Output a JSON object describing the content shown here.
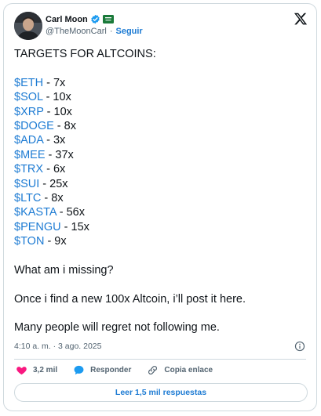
{
  "author": {
    "name": "Carl Moon",
    "handle": "@TheMoonCarl",
    "separator": "·",
    "follow_label": "Seguir"
  },
  "tweet": {
    "heading": "TARGETS FOR ALTCOINS:",
    "targets": [
      {
        "ticker": "$ETH",
        "target": " - 7x"
      },
      {
        "ticker": "$SOL",
        "target": " - 10x"
      },
      {
        "ticker": "$XRP",
        "target": " - 10x"
      },
      {
        "ticker": "$DOGE",
        "target": " - 8x"
      },
      {
        "ticker": "$ADA",
        "target": " - 3x"
      },
      {
        "ticker": "$MEE",
        "target": " - 37x"
      },
      {
        "ticker": "$TRX",
        "target": " - 6x"
      },
      {
        "ticker": "$SUI",
        "target": " - 25x"
      },
      {
        "ticker": "$LTC",
        "target": " - 8x"
      },
      {
        "ticker": "$KASTA",
        "target": " - 56x"
      },
      {
        "ticker": "$PENGU",
        "target": " - 15x"
      },
      {
        "ticker": "$TON",
        "target": " - 9x"
      }
    ],
    "question": "What am i missing?",
    "line_post": "Once i find a new 100x Altcoin, i’ll post it here.",
    "line_regret": "Many people will regret not following me.",
    "timestamp": "4:10 a. m. · 3 ago. 2025"
  },
  "actions": {
    "likes": "3,2 mil",
    "reply_label": "Responder",
    "copy_link_label": "Copia enlace"
  },
  "read_replies_label": "Leer 1,5 mil respuestas",
  "icons": {
    "verified": "verified-badge-icon",
    "flag": "saudi-flag-icon",
    "logo": "x-logo-icon",
    "info": "info-icon",
    "like": "heart-icon",
    "reply": "speech-bubble-icon",
    "link": "link-icon"
  },
  "colors": {
    "accent": "#1d7bd3",
    "like": "#f91880",
    "text": "#0f1419",
    "secondary": "#536471",
    "border": "#cfd9de"
  }
}
